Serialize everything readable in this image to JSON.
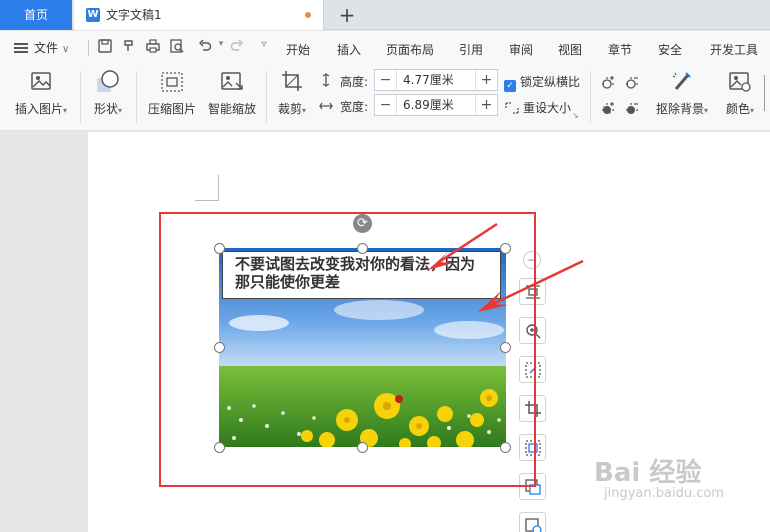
{
  "tabs": {
    "home": "首页",
    "document": "文字文稿1",
    "new_tab": "+"
  },
  "menubar": {
    "file": "文件",
    "items": [
      "开始",
      "插入",
      "页面布局",
      "引用",
      "审阅",
      "视图",
      "章节",
      "安全",
      "开发工具"
    ]
  },
  "ribbon": {
    "insert_picture": "插入图片",
    "shape": "形状",
    "compress_picture": "压缩图片",
    "smart_zoom": "智能缩放",
    "crop": "裁剪",
    "height_label": "高度:",
    "height_value": "4.77厘米",
    "width_label": "宽度:",
    "width_value": "6.89厘米",
    "lock_ratio": "锁定纵横比",
    "reset_size": "重设大小",
    "remove_background": "抠除背景",
    "color": "颜色"
  },
  "document": {
    "caption": "不要试图去改变我对你的看法，因为那只能使你更差"
  },
  "watermark": {
    "text": "Bai 经验",
    "sub": "jingyan.baidu.com"
  },
  "colors": {
    "accent": "#2b7de9",
    "highlight_red": "#e53935"
  }
}
